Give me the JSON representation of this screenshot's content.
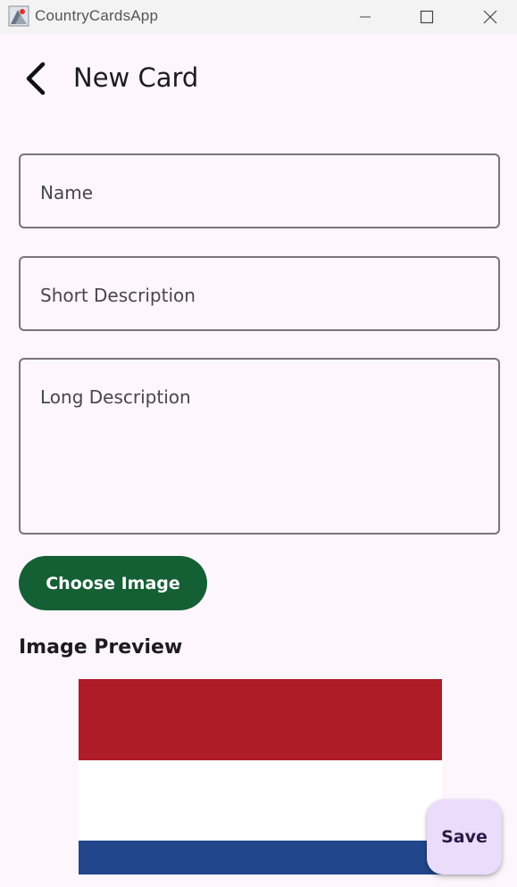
{
  "window": {
    "title": "CountryCardsApp",
    "icon": "app-icon",
    "controls": {
      "minimize_icon": "minimize-icon",
      "maximize_icon": "maximize-icon",
      "close_icon": "close-icon"
    }
  },
  "appbar": {
    "back_icon": "back-arrow-icon",
    "title": "New Card"
  },
  "form": {
    "name_placeholder": "Name",
    "short_description_placeholder": "Short Description",
    "long_description_placeholder": "Long Description",
    "choose_image_label": "Choose Image"
  },
  "preview": {
    "label": "Image Preview",
    "flag_stripes": [
      "#ae1c28",
      "#ffffff",
      "#21468b"
    ]
  },
  "actions": {
    "save_label": "Save"
  },
  "colors": {
    "background": "#fdf6fc",
    "primary_button": "#155f35",
    "fab": "#ebdcfb",
    "outline": "#7a7479"
  }
}
